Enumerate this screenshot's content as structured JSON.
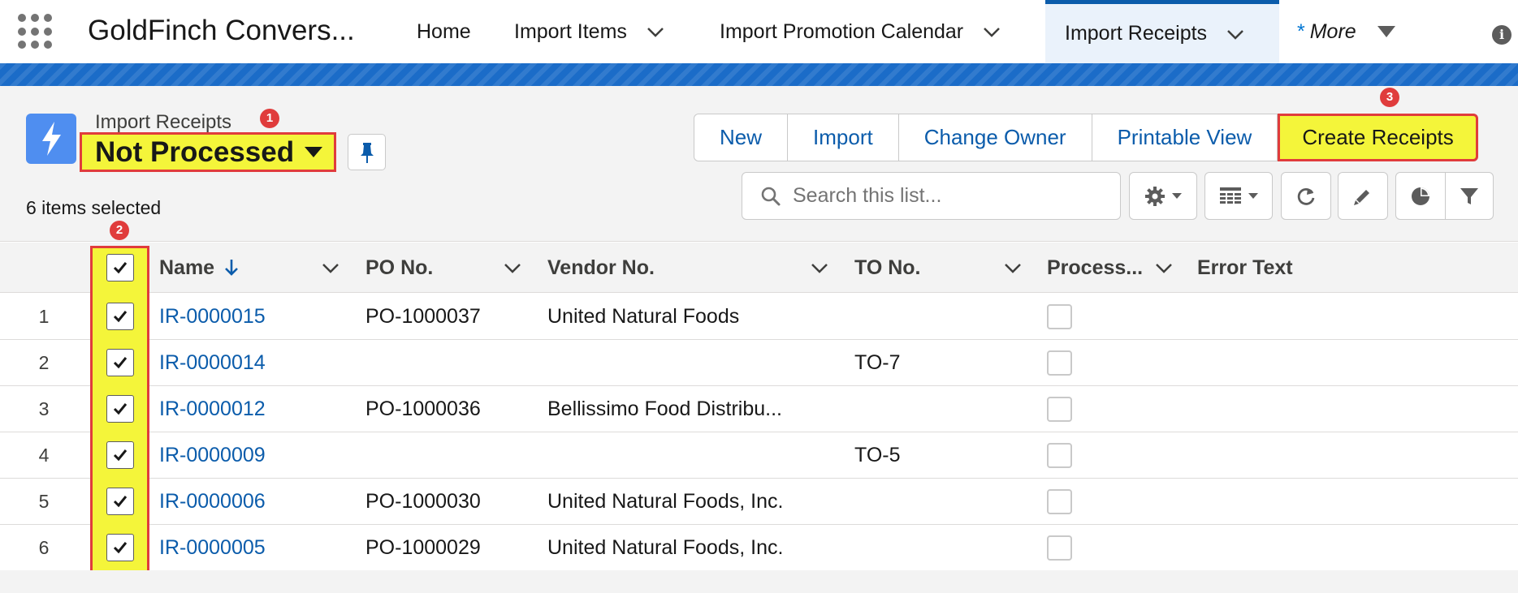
{
  "app": {
    "name": "GoldFinch Convers..."
  },
  "nav": {
    "tabs": [
      {
        "label": "Home",
        "has_menu": false
      },
      {
        "label": "Import Items",
        "has_menu": true
      },
      {
        "label": "Import Promotion Calendar",
        "has_menu": true
      },
      {
        "label": "Import Receipts",
        "has_menu": true,
        "active": true
      }
    ],
    "more": {
      "star": "*",
      "label": "More"
    }
  },
  "header": {
    "object_label": "Import Receipts",
    "list_view": "Not Processed",
    "selected_count_text": "6 items selected",
    "badges": [
      "1",
      "2",
      "3"
    ]
  },
  "actions": [
    "New",
    "Import",
    "Change Owner",
    "Printable View",
    "Create Receipts"
  ],
  "search": {
    "placeholder": "Search this list...",
    "value": ""
  },
  "toolbar_icons": [
    "gear-icon",
    "table-view-icon",
    "refresh-icon",
    "edit-icon",
    "chart-icon",
    "filter-icon"
  ],
  "table": {
    "columns": [
      "Name",
      "PO No.",
      "Vendor No.",
      "TO No.",
      "Process...",
      "Error Text"
    ],
    "rows": [
      {
        "num": "1",
        "name": "IR-0000015",
        "po": "PO-1000037",
        "vendor": "United Natural Foods",
        "to": "",
        "checked": true,
        "processed": false
      },
      {
        "num": "2",
        "name": "IR-0000014",
        "po": "",
        "vendor": "",
        "to": "TO-7",
        "checked": true,
        "processed": false
      },
      {
        "num": "3",
        "name": "IR-0000012",
        "po": "PO-1000036",
        "vendor": "Bellissimo Food Distribu...",
        "to": "",
        "checked": true,
        "processed": false
      },
      {
        "num": "4",
        "name": "IR-0000009",
        "po": "",
        "vendor": "",
        "to": "TO-5",
        "checked": true,
        "processed": false
      },
      {
        "num": "5",
        "name": "IR-0000006",
        "po": "PO-1000030",
        "vendor": "United Natural Foods, Inc.",
        "to": "",
        "checked": true,
        "processed": false
      },
      {
        "num": "6",
        "name": "IR-0000005",
        "po": "PO-1000029",
        "vendor": "United Natural Foods, Inc.",
        "to": "",
        "checked": true,
        "processed": false
      }
    ]
  },
  "colors": {
    "brand_blue": "#0b5cab",
    "highlight_yellow": "#f4f53a",
    "annotation_red": "#e03c3c"
  }
}
